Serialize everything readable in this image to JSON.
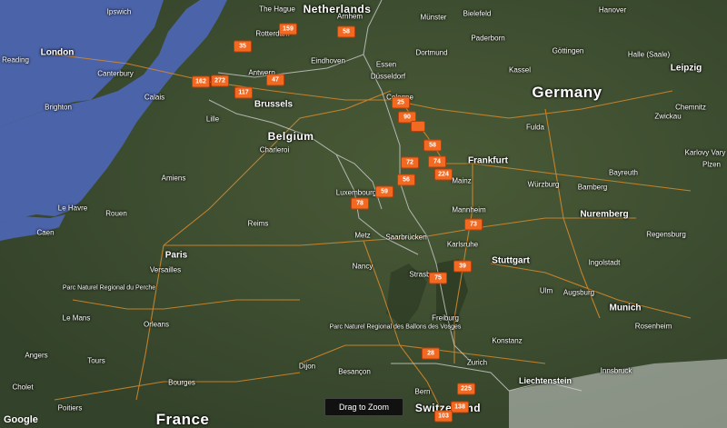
{
  "colors": {
    "land": "#3e4f31",
    "sea": "#4b63a8",
    "road": "#d98a2c",
    "border": "#c9c9c9",
    "marker": "#f26a22",
    "alps": "#d8d8d8"
  },
  "icons": {
    "marker": "orange-count-marker"
  },
  "labels": {
    "countries": [
      "Netherlands",
      "Germany",
      "Belgium",
      "France",
      "Switzerland"
    ],
    "cities": [
      "Ipswich",
      "London",
      "Reading",
      "Canterbury",
      "Brighton",
      "Calais",
      "Lille",
      "Antwerp",
      "Brussels",
      "Charleroi",
      "Amiens",
      "Rouen",
      "Le Havre",
      "Caen",
      "Reims",
      "Paris",
      "Versailles",
      "Le Mans",
      "Orleans",
      "Tours",
      "Angers",
      "Cholet",
      "Poitiers",
      "Dijon",
      "Besançon",
      "Bourges",
      "Metz",
      "Nancy",
      "Luxembourg",
      "Saarbrücken",
      "The Hague",
      "Rotterdam",
      "Arnhem",
      "Eindhoven",
      "Essen",
      "Dortmund",
      "Düsseldorf",
      "Cologne",
      "Münster",
      "Bielefeld",
      "Paderborn",
      "Hanover",
      "Kassel",
      "Göttingen",
      "Halle (Saale)",
      "Leipzig",
      "Chemnitz",
      "Zwickau",
      "Fulda",
      "Frankfurt",
      "Mainz",
      "Mannheim",
      "Karlsruhe",
      "Stuttgart",
      "Würzburg",
      "Bamberg",
      "Bayreuth",
      "Nuremberg",
      "Ingolstadt",
      "Munich",
      "Rosenheim",
      "Augsburg",
      "Ulm",
      "Freiburg",
      "Strasbourg",
      "Konstanz",
      "Zurich",
      "Bern",
      "Liechtenstein",
      "Innsbruck",
      "Regensburg",
      "Plzen",
      "Karlovy Vary"
    ],
    "poi": [
      "Parc Naturel Regional du Perche",
      "Parc Naturel Regional des Ballons des Vosges"
    ]
  },
  "markers": [
    {
      "label": "159"
    },
    {
      "label": "58"
    },
    {
      "label": "35"
    },
    {
      "label": "162"
    },
    {
      "label": "272"
    },
    {
      "label": "117"
    },
    {
      "label": "47"
    },
    {
      "label": "25"
    },
    {
      "label": "90"
    },
    {
      "label": ""
    },
    {
      "label": "58"
    },
    {
      "label": "72"
    },
    {
      "label": "74"
    },
    {
      "label": "224"
    },
    {
      "label": "56"
    },
    {
      "label": "59"
    },
    {
      "label": "78"
    },
    {
      "label": "73"
    },
    {
      "label": "39"
    },
    {
      "label": "75"
    },
    {
      "label": "28"
    },
    {
      "label": "225"
    },
    {
      "label": "138"
    },
    {
      "label": "103"
    }
  ],
  "controls": {
    "drag_to_zoom": "Drag to Zoom"
  },
  "branding": {
    "logo": "Google"
  }
}
